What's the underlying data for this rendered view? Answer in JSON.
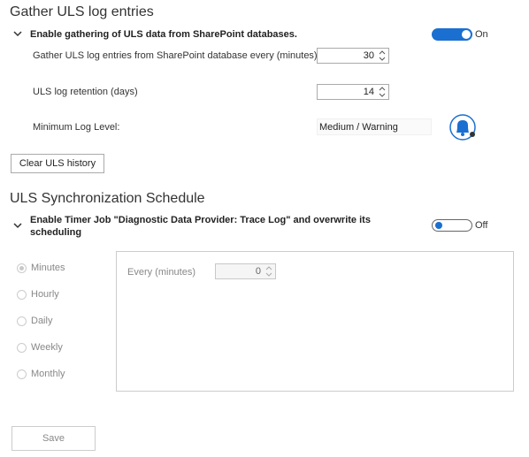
{
  "gather": {
    "title": "Gather ULS log entries",
    "enable_label": "Enable gathering of ULS data from SharePoint databases.",
    "toggle_state": "On",
    "interval_label": "Gather ULS log entries from SharePoint database every (minutes)",
    "interval_value": "30",
    "retention_label": "ULS log retention (days)",
    "retention_value": "14",
    "min_level_label": "Minimum Log Level:",
    "min_level_value": "Medium / Warning",
    "clear_button": "Clear ULS history"
  },
  "schedule": {
    "title": "ULS Synchronization Schedule",
    "enable_label": "Enable Timer Job \"Diagnostic Data Provider: Trace Log\" and overwrite its scheduling",
    "toggle_state": "Off",
    "options": [
      "Minutes",
      "Hourly",
      "Daily",
      "Weekly",
      "Monthly"
    ],
    "selected": "Minutes",
    "every_label": "Every (minutes)",
    "every_value": "0"
  },
  "footer": {
    "save_button": "Save"
  },
  "colors": {
    "accent": "#1a6fd1",
    "bell_icon": "#1a6fd1"
  }
}
